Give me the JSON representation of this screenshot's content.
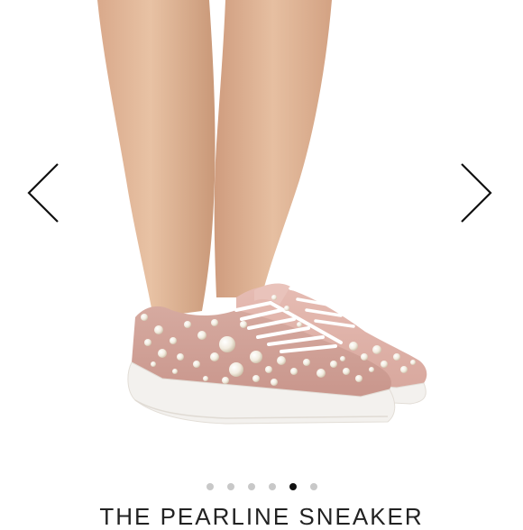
{
  "product": {
    "title": "THE PEARLINE SNEAKER"
  },
  "carousel": {
    "total_slides": 6,
    "active_index": 4,
    "prev_icon": "chevron-left-icon",
    "next_icon": "chevron-right-icon"
  },
  "colors": {
    "shoe_pink": "#d9a9a1",
    "sole_white": "#f3f1ee",
    "pearl": "#f5efe4",
    "active_dot": "#111111",
    "inactive_dot": "#c8c8c8"
  }
}
